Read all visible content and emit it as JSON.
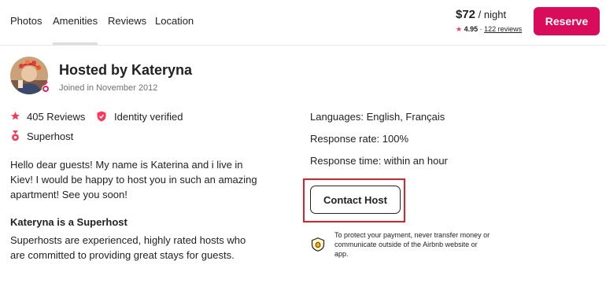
{
  "nav": {
    "tabs": [
      "Photos",
      "Amenities",
      "Reviews",
      "Location"
    ],
    "active_tab": "Amenities"
  },
  "booking": {
    "price": "$72",
    "price_unit": " / night",
    "rating": "4.95",
    "separator": "·",
    "reviews_link": "122 reviews",
    "reserve_label": "Reserve",
    "accent_color": "#D90B5B"
  },
  "host": {
    "title": "Hosted by Kateryna",
    "joined": "Joined in November 2012",
    "stats": [
      {
        "icon": "star-icon",
        "label": "405 Reviews"
      },
      {
        "icon": "shield-check-icon",
        "label": "Identity verified"
      },
      {
        "icon": "medal-icon",
        "label": "Superhost"
      }
    ],
    "description": "Hello dear guests! My name is Katerina and i live in Kiev! I would be happy to host you in such an amazing apartment! See you soon!",
    "superhost_heading": "Kateryna is a Superhost",
    "superhost_text": "Superhosts are experienced, highly rated hosts who are committed to providing great stays for guests."
  },
  "details": {
    "languages": "Languages: English, Français",
    "response_rate": "Response rate: 100%",
    "response_time": "Response time: within an hour",
    "contact_label": "Contact Host",
    "protect_text": "To protect your payment, never transfer money or communicate outside of the Airbnb website or app."
  }
}
